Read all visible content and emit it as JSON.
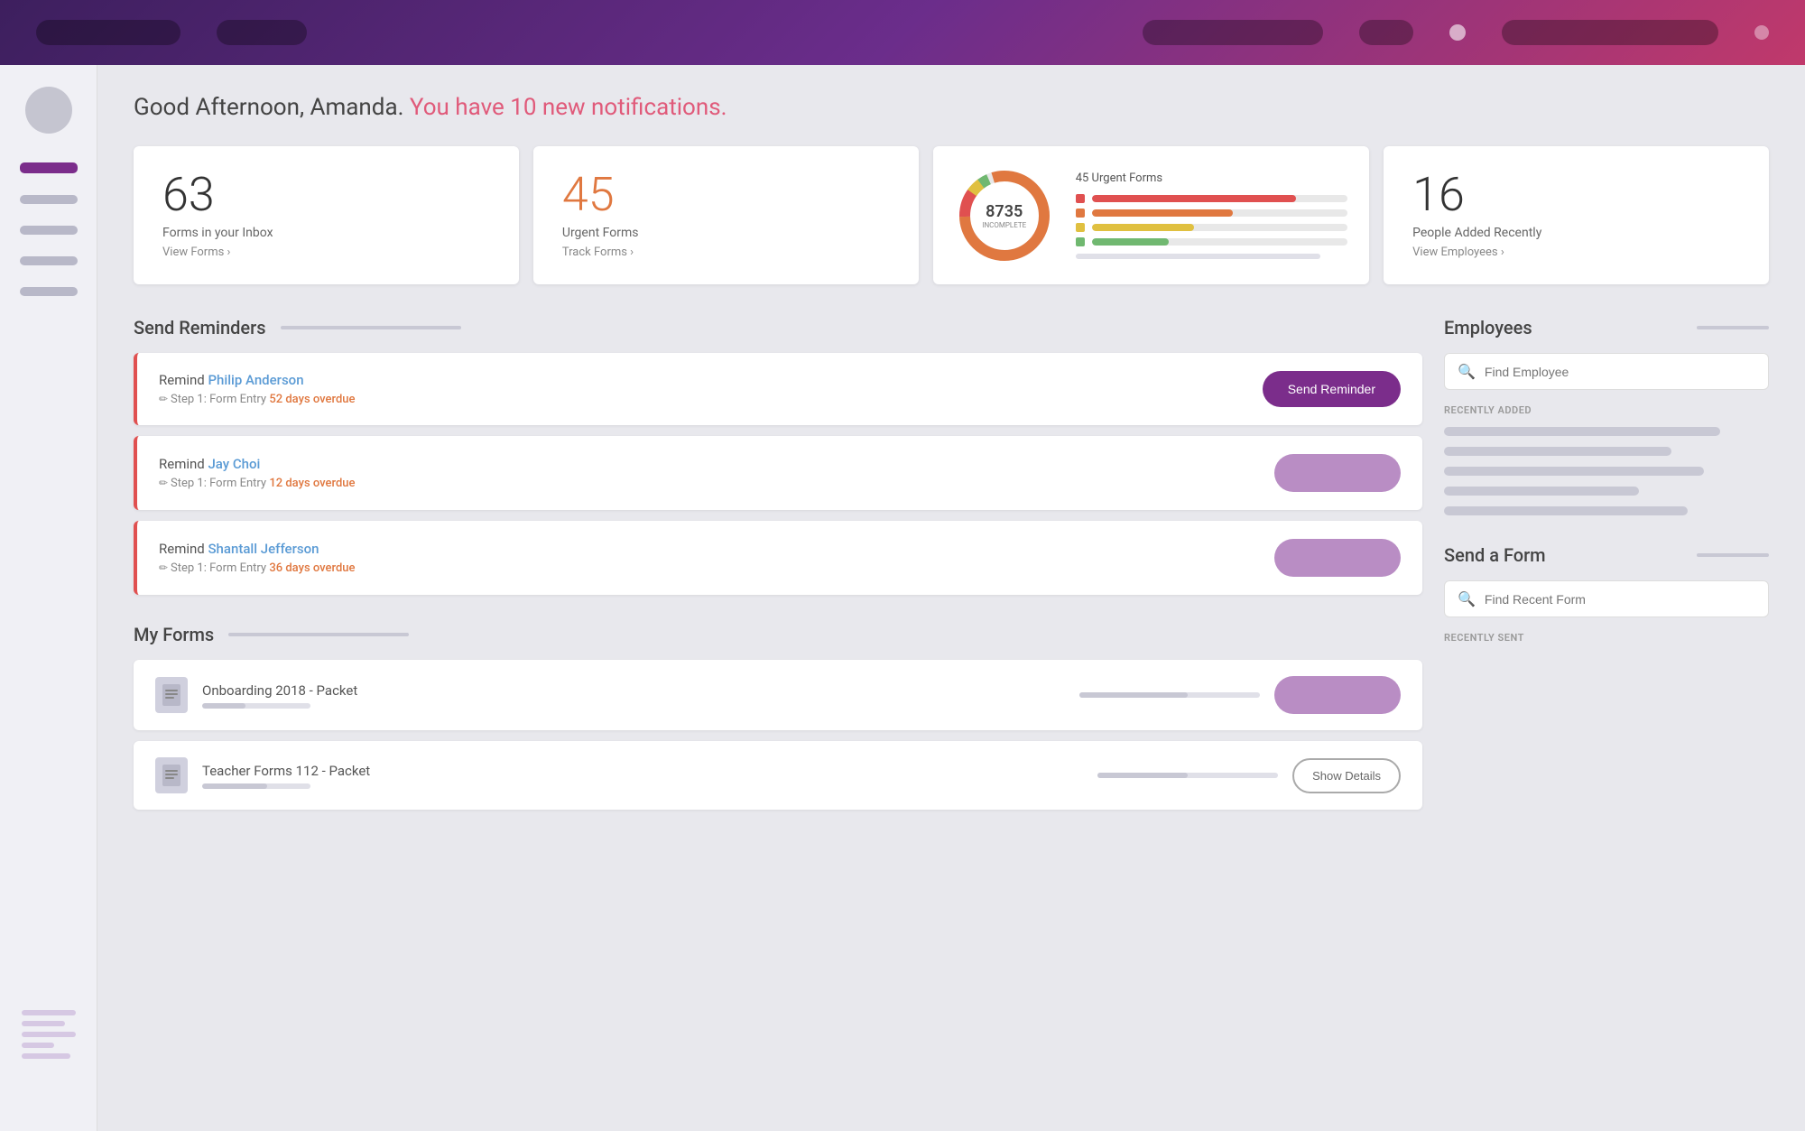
{
  "nav": {
    "pill1": "",
    "pill2": "",
    "pill3": "",
    "pill4": "",
    "pill5": ""
  },
  "greeting": {
    "prefix": "Good Afternoon, Amanda.",
    "suffix": " You have 10 new notifications."
  },
  "stats": {
    "inbox": {
      "number": "63",
      "label": "Forms in your Inbox",
      "link": "View Forms ›"
    },
    "urgent": {
      "number": "45",
      "label": "Urgent Forms",
      "link": "Track Forms ›"
    },
    "chart": {
      "center_number": "8735",
      "center_label": "INCOMPLETE",
      "legend_title": "45 Urgent Forms",
      "bars": [
        {
          "color": "#e05050",
          "width": "80%"
        },
        {
          "color": "#e07840",
          "width": "55%"
        },
        {
          "color": "#e0a840",
          "width": "40%"
        },
        {
          "color": "#70b870",
          "width": "30%"
        }
      ]
    },
    "people": {
      "number": "16",
      "label": "People Added Recently",
      "link": "View Employees ›"
    }
  },
  "reminders": {
    "section_title": "Send Reminders",
    "items": [
      {
        "prefix": "Remind ",
        "name": "Philip Anderson",
        "step": "Step 1: Form Entry",
        "overdue": "52 days overdue",
        "btn_label": "Send Reminder"
      },
      {
        "prefix": "Remind ",
        "name": "Jay Choi",
        "step": "Step 1: Form Entry",
        "overdue": "12 days overdue",
        "btn_label": ""
      },
      {
        "prefix": "Remind ",
        "name": "Shantall Jefferson",
        "step": "Step 1: Form Entry",
        "overdue": "36 days overdue",
        "btn_label": ""
      }
    ]
  },
  "my_forms": {
    "section_title": "My Forms",
    "items": [
      {
        "name": "Onboarding 2018",
        "suffix": " - Packet",
        "progress": 40,
        "btn_label": ""
      },
      {
        "name": "Teacher Forms 112",
        "suffix": " - Packet",
        "progress": 60,
        "btn_label": "Show Details"
      }
    ]
  },
  "employees": {
    "panel_title": "Employees",
    "search_placeholder": "Find Employee",
    "recently_label": "RECENTLY ADDED"
  },
  "send_form": {
    "panel_title": "Send a Form",
    "search_placeholder": "Find Recent Form",
    "recently_label": "RECENTLY SENT"
  }
}
